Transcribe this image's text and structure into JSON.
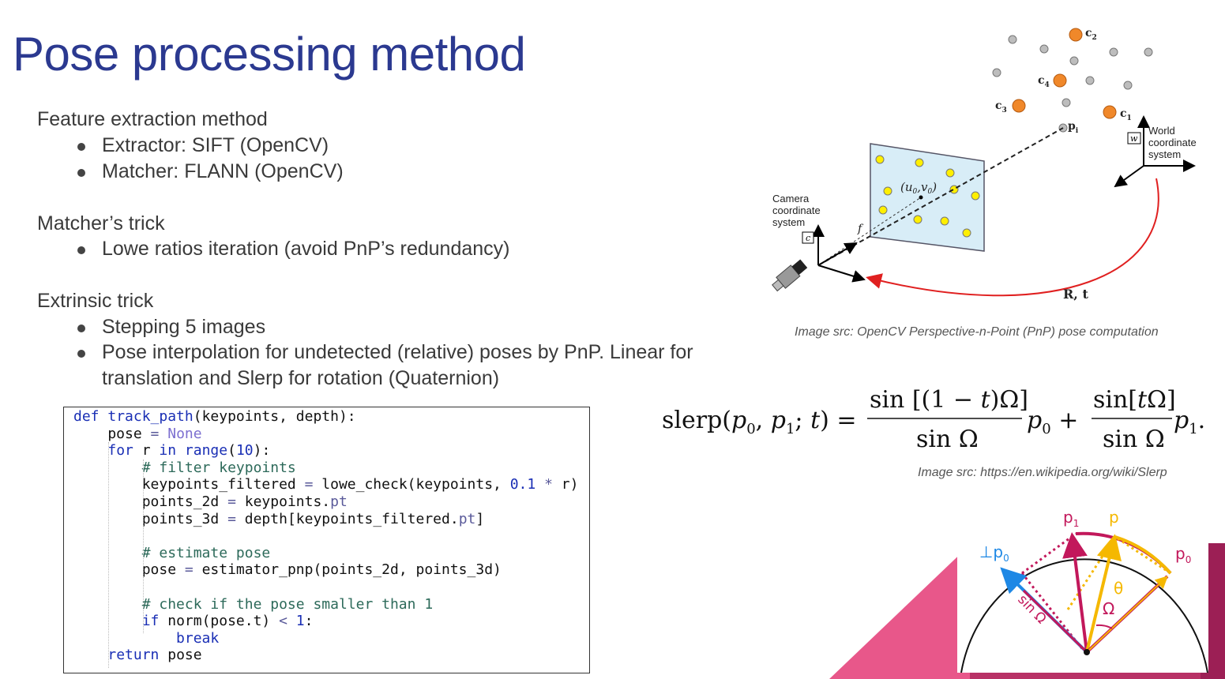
{
  "title": "Pose processing method",
  "sections": [
    {
      "heading": "Feature extraction method",
      "bullets": [
        "Extractor: SIFT (OpenCV)",
        "Matcher: FLANN (OpenCV)"
      ]
    },
    {
      "heading": "Matcher’s trick",
      "bullets": [
        "Lowe ratios iteration (avoid PnP’s redundancy)"
      ]
    },
    {
      "heading": "Extrinsic trick",
      "bullets": [
        "Stepping 5 images",
        "Pose interpolation for undetected (relative) poses by PnP. Linear for",
        "translation and Slerp for rotation (Quaternion)"
      ]
    }
  ],
  "pnp_figure": {
    "caption": "Image src: OpenCV Perspective-n-Point (PnP) pose computation",
    "labels": {
      "camera": [
        "Camera",
        "coordinate",
        "system"
      ],
      "world": [
        "World",
        "coordinate",
        "system"
      ],
      "rt": "R, t",
      "c": "c",
      "w": "w",
      "f": "f",
      "pi": "p",
      "pi_sub": "i",
      "ui": "u",
      "ui_sub": "i",
      "uv": "(u",
      "c1": "c",
      "c2": "c",
      "c3": "c",
      "c4": "c"
    }
  },
  "slerp": {
    "caption": "Image src: https://en.wikipedia.org/wiki/Slerp",
    "lhs": "slerp(p",
    "num1": "sin [(1 − t)Ω]",
    "num2": "sin[tΩ]",
    "den": "sin Ω"
  },
  "slerp_figure": {
    "labels": {
      "p1": "p",
      "p": "p",
      "p0": "p",
      "perp": "⊥p",
      "theta": "θ",
      "omega": "Ω",
      "sin": "sin Ω"
    }
  },
  "colors": {
    "title": "#2b3990",
    "accent_pink": "#e8578a",
    "accent_dark": "#9c1f55",
    "orange": "#f39c1f",
    "yellow": "#ffe600"
  }
}
